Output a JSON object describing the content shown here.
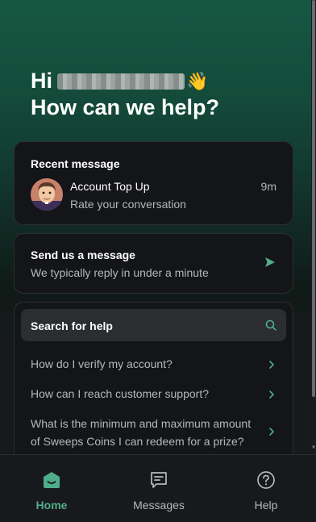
{
  "header": {
    "greeting": "Hi",
    "wave_emoji": "👋",
    "subtitle": "How can we help?"
  },
  "recent": {
    "title": "Recent message",
    "conversation_title": "Account Top Up",
    "conversation_subtitle": "Rate your conversation",
    "time": "9m"
  },
  "send": {
    "title": "Send us a message",
    "subtitle": "We typically reply in under a minute"
  },
  "search": {
    "label": "Search for help",
    "articles": [
      "How do I verify my account?",
      "How can I reach customer support?",
      "What is the minimum and maximum amount of Sweeps Coins I can redeem for a prize?"
    ]
  },
  "nav": {
    "home": "Home",
    "messages": "Messages",
    "help": "Help"
  },
  "colors": {
    "accent": "#4fae8a",
    "background": "#18191c",
    "card": "#141518",
    "header_green": "#165843"
  },
  "icons": [
    "wave-icon",
    "avatar",
    "send-arrow-icon",
    "search-icon",
    "chevron-right-icon",
    "home-icon",
    "messages-icon",
    "help-icon"
  ]
}
